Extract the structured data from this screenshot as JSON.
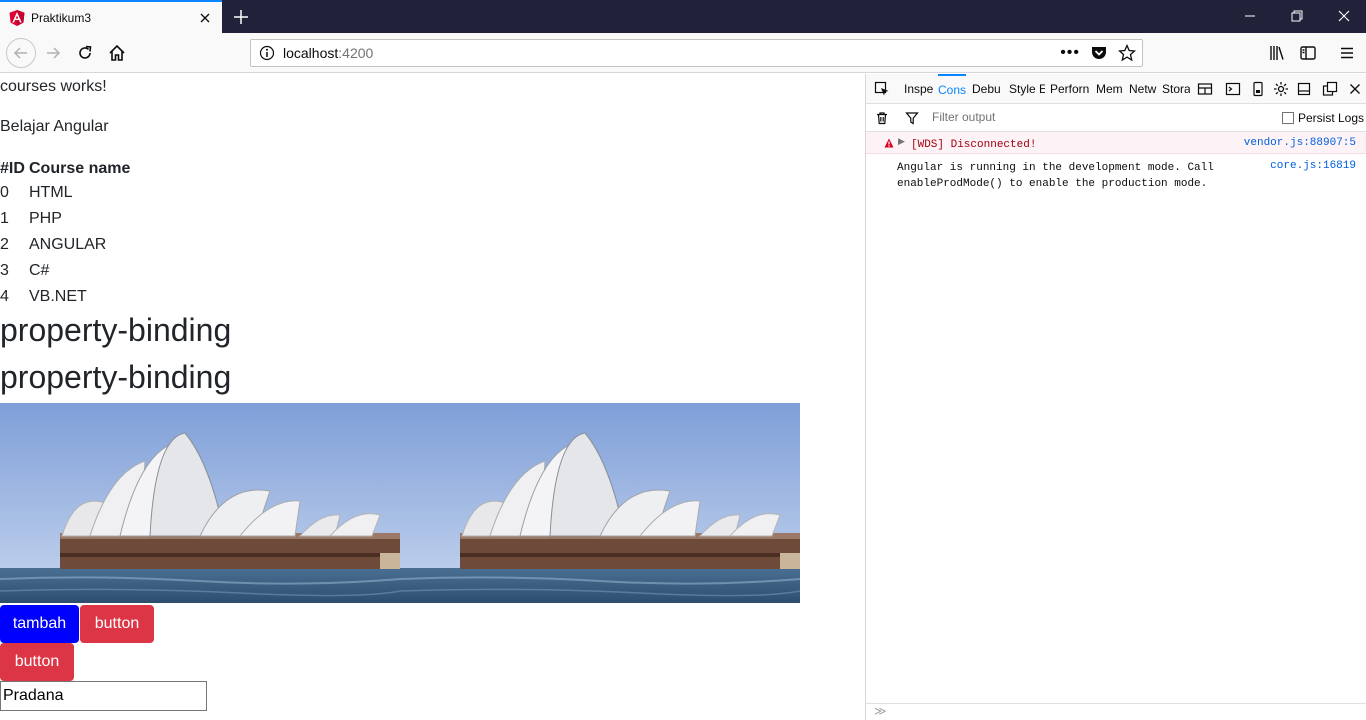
{
  "browser": {
    "tab_title": "Praktikum3",
    "url_host": "localhost",
    "url_port": ":4200"
  },
  "page": {
    "line1": "courses works!",
    "line2": "Belajar Angular",
    "table": {
      "headers": [
        "#ID",
        "Course name"
      ],
      "rows": [
        {
          "id": "0",
          "name": "HTML"
        },
        {
          "id": "1",
          "name": "PHP"
        },
        {
          "id": "2",
          "name": "ANGULAR"
        },
        {
          "id": "3",
          "name": "C#"
        },
        {
          "id": "4",
          "name": "VB.NET"
        }
      ]
    },
    "heading1": "property-binding",
    "heading2": "property-binding",
    "buttons": {
      "tambah": "tambah",
      "button1": "button",
      "button2": "button"
    },
    "input_value": "Pradana"
  },
  "devtools": {
    "tabs": [
      "Inspe",
      "Cons",
      "Debu",
      "Style E",
      "Perforn",
      "Mem",
      "Netw",
      "Stora"
    ],
    "filter_placeholder": "Filter output",
    "persist_logs": "Persist Logs",
    "messages": [
      {
        "text": "[WDS] Disconnected!",
        "source": "vendor.js:88907:5",
        "level": "error"
      },
      {
        "text_line1": "Angular is running in the development mode. Call",
        "text_line2": "enableProdMode() to enable the production mode.",
        "source": "core.js:16819",
        "level": "log"
      }
    ]
  },
  "colors": {
    "accent": "#0a84ff",
    "btn_blue": "#0000ff",
    "btn_red": "#dc3545",
    "titlebar": "#1f2238"
  }
}
